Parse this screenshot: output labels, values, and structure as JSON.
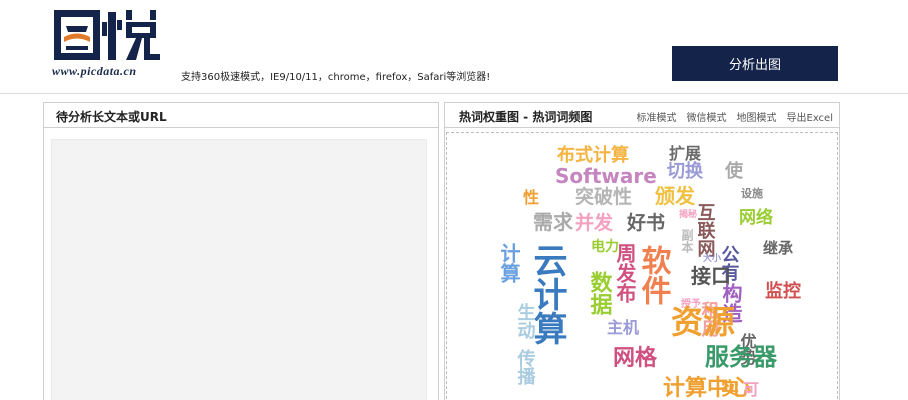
{
  "header": {
    "logo_url_text": "www.picdata.cn",
    "tagline": "支持360极速模式，IE9/10/11，chrome，firefox，Safari等浏览器!",
    "analyze_button": "分析出图"
  },
  "left_panel": {
    "title": "待分析长文本或URL"
  },
  "right_panel": {
    "title": "热词权重图 - 热词词频图",
    "modes": [
      "标准模式",
      "微信模式",
      "地图模式",
      "导出Excel"
    ]
  },
  "word_cloud": [
    {
      "text": "布式计算",
      "color": "#f5b342"
    },
    {
      "text": "扩展",
      "color": "#6a6a6a"
    },
    {
      "text": "Software",
      "color": "#c586c0"
    },
    {
      "text": "切换",
      "color": "#9a9ad6"
    },
    {
      "text": "使",
      "color": "#aaaaaa"
    },
    {
      "text": "突破性",
      "color": "#b5b5b5"
    },
    {
      "text": "颁发",
      "color": "#f0c040"
    },
    {
      "text": "互联网",
      "color": "#8a5a5a"
    },
    {
      "text": "设施",
      "color": "#888888"
    },
    {
      "text": "网络",
      "color": "#9acd32"
    },
    {
      "text": "性",
      "color": "#f0a030"
    },
    {
      "text": "需求",
      "color": "#aaaaaa"
    },
    {
      "text": "并发",
      "color": "#f4a0c0"
    },
    {
      "text": "好书",
      "color": "#666666"
    },
    {
      "text": "揭秘",
      "color": "#f4a0c0"
    },
    {
      "text": "副本",
      "color": "#bbbbbb"
    },
    {
      "text": "公有",
      "color": "#5a5aa0"
    },
    {
      "text": "继承",
      "color": "#666666"
    },
    {
      "text": "计算",
      "color": "#6aa0e0"
    },
    {
      "text": "云计算",
      "color": "#3a7abf"
    },
    {
      "text": "电力",
      "color": "#9acd32"
    },
    {
      "text": "周发布",
      "color": "#d05080"
    },
    {
      "text": "软件",
      "color": "#f08050"
    },
    {
      "text": "接口",
      "color": "#555555"
    },
    {
      "text": "大小",
      "color": "#9a9ad6"
    },
    {
      "text": "数据",
      "color": "#9acd32"
    },
    {
      "text": "构造",
      "color": "#a060c0"
    },
    {
      "text": "监控",
      "color": "#d05050"
    },
    {
      "text": "授予",
      "color": "#f4a0c0"
    },
    {
      "text": "租用",
      "color": "#f4a0a0"
    },
    {
      "text": "主机",
      "color": "#9a9ad6"
    },
    {
      "text": "资源",
      "color": "#f0a030"
    },
    {
      "text": "生动",
      "color": "#aacce0"
    },
    {
      "text": "优势",
      "color": "#666666"
    },
    {
      "text": "网格",
      "color": "#d05080"
    },
    {
      "text": "服务器",
      "color": "#3a9a6a"
    },
    {
      "text": "传播",
      "color": "#aacce0"
    },
    {
      "text": "计算中心",
      "color": "#f0a030"
    },
    {
      "text": "实",
      "color": "#f0a030"
    },
    {
      "text": "可",
      "color": "#f4a0c0"
    }
  ]
}
